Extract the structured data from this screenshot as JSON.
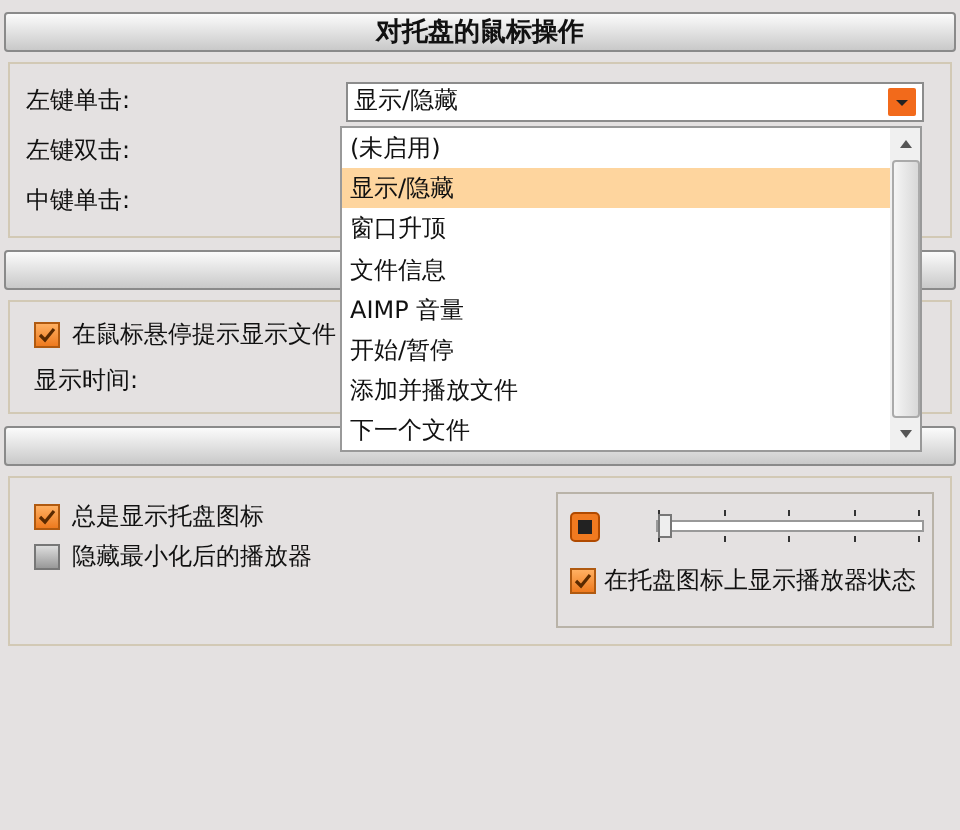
{
  "mouse_section": {
    "title": "对托盘的鼠标操作",
    "rows": [
      {
        "label": "左键单击:"
      },
      {
        "label": "左键双击:"
      },
      {
        "label": "中键单击:"
      }
    ],
    "combo": {
      "value": "显示/隐藏",
      "expanded": true
    },
    "options": [
      {
        "label": "(未启用)",
        "selected": false
      },
      {
        "label": "显示/隐藏",
        "selected": true
      },
      {
        "label": "窗口升顶",
        "selected": false
      },
      {
        "label": "文件信息",
        "selected": false
      },
      {
        "label": "AIMP 音量",
        "selected": false
      },
      {
        "label": "开始/暂停",
        "selected": false
      },
      {
        "label": "添加并播放文件",
        "selected": false
      },
      {
        "label": "下一个文件",
        "selected": false
      }
    ]
  },
  "hint_section": {
    "checkbox": {
      "label": "在鼠标悬停提示显示文件",
      "checked": true
    },
    "time_label": "显示时间:"
  },
  "tray_section": {
    "checkboxes": [
      {
        "label": "总是显示托盘图标",
        "checked": true
      },
      {
        "label": "隐藏最小化后的播放器",
        "checked": false
      }
    ],
    "slider": {
      "level": 0
    },
    "state_checkbox": {
      "label": "在托盘图标上显示播放器状态",
      "checked": true
    }
  }
}
